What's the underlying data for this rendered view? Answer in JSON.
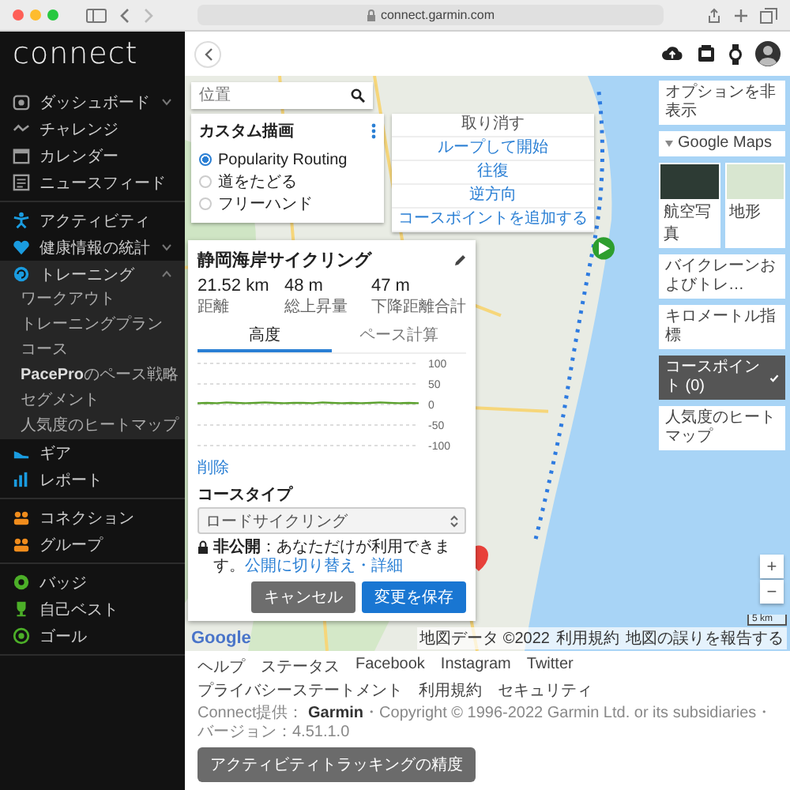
{
  "browser": {
    "url": "connect.garmin.com"
  },
  "sidebar": {
    "logo": "connect",
    "groups": [
      {
        "items": [
          {
            "label": "ダッシュボード",
            "color": "#9a9a9a",
            "expanded": false
          },
          {
            "label": "チャレンジ",
            "color": "#9a9a9a"
          },
          {
            "label": "カレンダー",
            "color": "#9a9a9a"
          },
          {
            "label": "ニュースフィード",
            "color": "#9a9a9a"
          }
        ]
      },
      {
        "items": [
          {
            "label": "アクティビティ",
            "color": "#1a9ce0"
          },
          {
            "label": "健康情報の統計",
            "color": "#1a9ce0",
            "expanded": false
          },
          {
            "label": "トレーニング",
            "color": "#1a9ce0",
            "expanded": true,
            "children": [
              {
                "label": "ワークアウト"
              },
              {
                "label": "トレーニングプラン"
              },
              {
                "label": "コース"
              },
              {
                "label": "**PacePro**のペース戦略"
              },
              {
                "label": "セグメント"
              },
              {
                "label": "人気度のヒートマップ"
              }
            ]
          },
          {
            "label": "ギア",
            "color": "#1a9ce0"
          },
          {
            "label": "レポート",
            "color": "#1a9ce0"
          }
        ]
      },
      {
        "items": [
          {
            "label": "コネクション",
            "color": "#f08c1c"
          },
          {
            "label": "グループ",
            "color": "#f08c1c"
          }
        ]
      },
      {
        "items": [
          {
            "label": "バッジ",
            "color": "#4caf28"
          },
          {
            "label": "自己ベスト",
            "color": "#4caf28"
          },
          {
            "label": "ゴール",
            "color": "#4caf28"
          }
        ]
      }
    ]
  },
  "search": {
    "placeholder": "位置"
  },
  "custom_route": {
    "title": "カスタム描画",
    "options": [
      {
        "label": "Popularity Routing",
        "selected": true
      },
      {
        "label": "道をたどる",
        "selected": false
      },
      {
        "label": "フリーハンド",
        "selected": false
      }
    ]
  },
  "route_menu": {
    "items": [
      {
        "label": "取り消す",
        "disabled": true
      },
      {
        "label": "ループして開始",
        "disabled": false
      },
      {
        "label": "往復",
        "disabled": false
      },
      {
        "label": "逆方向",
        "disabled": false
      },
      {
        "label": "コースポイントを追加する",
        "disabled": false
      }
    ]
  },
  "course": {
    "title": "静岡海岸サイクリング",
    "stats": [
      {
        "value": "21.52 km",
        "label": "距離"
      },
      {
        "value": "48 m",
        "label": "総上昇量"
      },
      {
        "value": "47 m",
        "label": "下降距離合計"
      }
    ],
    "tabs": [
      {
        "label": "高度",
        "selected": true
      },
      {
        "label": "ペース計算",
        "selected": false
      }
    ],
    "chart_data": {
      "type": "line",
      "grid": true,
      "ylim": [
        -100,
        100
      ],
      "yticks": [
        100,
        50,
        0,
        -50,
        -100
      ],
      "series": [
        {
          "color": "#5aa02c",
          "values": [
            3,
            4,
            3,
            5,
            4,
            3,
            4,
            5,
            4,
            3,
            4,
            4,
            3,
            5,
            4,
            3,
            4,
            3,
            4,
            5,
            4,
            3,
            4,
            3
          ]
        }
      ]
    },
    "delete_link": "削除",
    "course_type_label": "コースタイプ",
    "course_type": "ロードサイクリング",
    "privacy": "**非公開**：あなただけが利用できます。",
    "privacy_link": "公開に切り替え・詳細",
    "cancel": "キャンセル",
    "save": "変更を保存"
  },
  "map_layers": {
    "toggle": "オプションを非表示",
    "base_map": "Google Maps",
    "base_types": [
      {
        "label": "航空写真",
        "selected": false
      },
      {
        "label": "地形",
        "selected": false
      }
    ],
    "layers": [
      {
        "label": "バイクレーンおよびトレ…",
        "on": false
      },
      {
        "label": "キロメートル指標",
        "on": false
      },
      {
        "label": "コースポイント (0)",
        "on": true
      },
      {
        "label": "人気度のヒートマップ",
        "on": false
      }
    ]
  },
  "map": {
    "google": "Google",
    "zoom": [
      "+",
      "−"
    ],
    "scale": "5 km",
    "attribution": [
      "地図データ ©2022",
      "利用規約",
      "地図の誤りを報告する"
    ]
  },
  "footer": {
    "links": [
      "ヘルプ",
      "ステータス",
      "Facebook",
      "Instagram",
      "Twitter",
      "プライバシーステートメント",
      "利用規約",
      "セキュリティ"
    ],
    "copyright": "Connect提供： **Garmin**・Copyright © 1996-2022 Garmin Ltd. or its subsidiaries・バージョン：4.51.1.0"
  },
  "bottom_button": "アクティビティトラッキングの精度"
}
